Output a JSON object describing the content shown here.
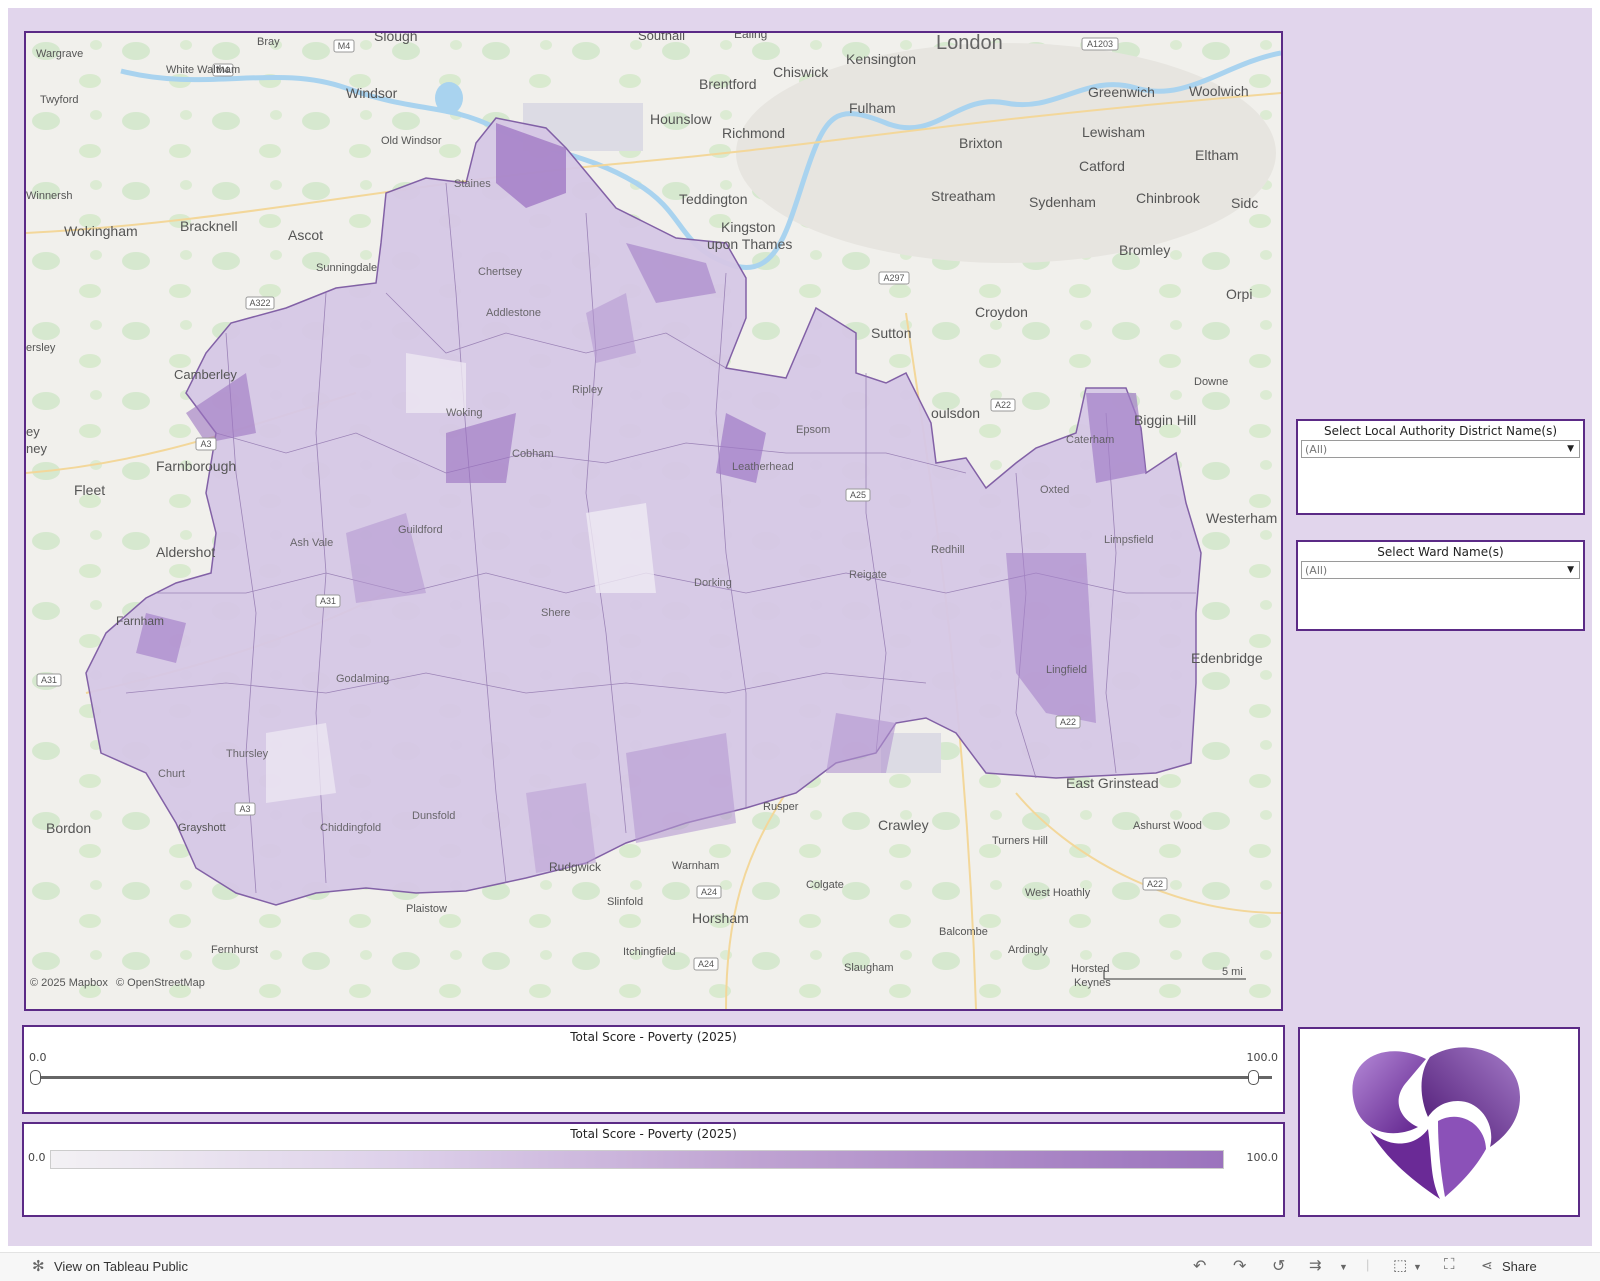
{
  "map": {
    "attribution_mapbox": "© 2025 Mapbox",
    "attribution_osm": "© OpenStreetMap",
    "scale_label": "5 mi",
    "colors": {
      "region_light": "#ece6f2",
      "region_mid": "#c9b3dc",
      "region_dark": "#9a6fc0",
      "border": "#5b2a86"
    },
    "place_labels": {
      "london": "London",
      "slough": "Slough",
      "southall": "Southall",
      "ealing": "Ealing",
      "bray": "Bray",
      "wargrave": "Wargrave",
      "white_waltham": "White Waltham",
      "twyford": "Twyford",
      "windsor": "Windsor",
      "old_windsor": "Old Windsor",
      "wokingham": "Wokingham",
      "winnersh": "Winnersh",
      "bracknell": "Bracknell",
      "ascot": "Ascot",
      "sunningdale": "Sunningdale",
      "crowthorne_frag": "ersley",
      "camberley": "Camberley",
      "farnborough": "Farnborough",
      "yateley_frag": "ey",
      "hartney_frag": "ney",
      "fleet": "Fleet",
      "aldershot": "Aldershot",
      "farnham": "Farnham",
      "bordon": "Bordon",
      "grayshott": "Grayshott",
      "fernhurst": "Fernhurst",
      "plaistow": "Plaistow",
      "rudgwick": "Rudgwick",
      "slinfold": "Slinfold",
      "itchingfield": "Itchingfield",
      "horsham": "Horsham",
      "warnham": "Warnham",
      "colgate": "Colgate",
      "slaugham": "Slaugham",
      "crawley": "Crawley",
      "rusper": "Rusper",
      "turners_hill": "Turners Hill",
      "west_hoathly": "West Hoathly",
      "balcombe": "Balcombe",
      "ardingly": "Ardingly",
      "horsted_keynes_1": "Horsted",
      "horsted_keynes_2": "Keynes",
      "east_grinstead": "East Grinstead",
      "ashurst_wood": "Ashurst Wood",
      "edenbridge": "Edenbridge",
      "westerham": "Westerham",
      "biggin_hill": "Biggin Hill",
      "downe": "Downe",
      "orpington_frag": "Orpi",
      "sidcup_frag": "Sidc",
      "bromley": "Bromley",
      "chinbrook": "Chinbrook",
      "sydenham": "Sydenham",
      "catford": "Catford",
      "lewisham": "Lewisham",
      "eltham": "Eltham",
      "greenwich": "Greenwich",
      "woolwich": "Woolwich",
      "kensington": "Kensington",
      "chiswick": "Chiswick",
      "brentford": "Brentford",
      "fulham": "Fulham",
      "hounslow": "Hounslow",
      "richmond": "Richmond",
      "brixton": "Brixton",
      "teddington": "Teddington",
      "kingston_1": "Kingston",
      "kingston_2": "upon Thames",
      "streatham": "Streatham",
      "croydon": "Croydon",
      "sutton": "Sutton",
      "coulsdon_frag": "oulsdon",
      "staines": "Staines",
      "chertsey": "Chertsey",
      "addlestone": "Addlestone",
      "woking": "Woking",
      "guildford": "Guildford",
      "godalming": "Godalming",
      "thursley": "Thursley",
      "churt": "Churt",
      "chiddingfold": "Chiddingfold",
      "dunsfold": "Dunsfold",
      "shere": "Shere",
      "dorking": "Dorking",
      "reigate": "Reigate",
      "redhill": "Redhill",
      "oxted": "Oxted",
      "lingfield": "Lingfield",
      "caterham": "Caterham",
      "epsom": "Epsom",
      "leatherhead": "Leatherhead",
      "ripley": "Ripley",
      "limpsfield": "Limpsfield",
      "ash_vale": "Ash Vale",
      "cobham": "Cobham"
    },
    "road_labels": {
      "m4_a": "M4",
      "m4_b": "M4",
      "a1203": "A1203",
      "a322": "A322",
      "a297": "A297",
      "a22_a": "A22",
      "a31_a": "A31",
      "a31_b": "A31",
      "a3_a": "A3",
      "a3_b": "A3",
      "a24_a": "A24",
      "a24_b": "A24",
      "a22_b": "A22",
      "a22_c": "A22",
      "a25": "A25"
    }
  },
  "filters": {
    "lad": {
      "title": "Select Local Authority District Name(s)",
      "value": "(All)"
    },
    "ward": {
      "title": "Select Ward Name(s)",
      "value": "(All)"
    }
  },
  "slider": {
    "title": "Total Score - Poverty (2025)",
    "min_label": "0.0",
    "max_label": "100.0",
    "low": 0.0,
    "high": 100.0
  },
  "legend": {
    "title": "Total Score - Poverty (2025)",
    "min_label": "0.0",
    "max_label": "100.0"
  },
  "logo": {
    "colors": {
      "dark": "#5d1f8a",
      "light": "#b58ad8"
    }
  },
  "toolbar": {
    "view_on_tableau": "View on Tableau Public",
    "share": "Share"
  }
}
